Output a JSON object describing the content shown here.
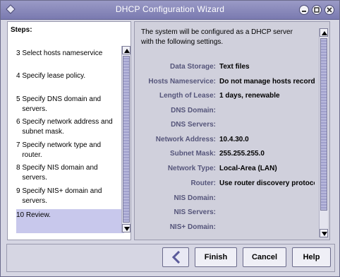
{
  "window": {
    "title": "DHCP Configuration Wizard"
  },
  "steps": {
    "heading": "Steps:",
    "items": [
      {
        "label": "3 Select hosts nameservice"
      },
      {
        "label": "4 Specify lease policy."
      },
      {
        "label": "5 Specify DNS domain and\n   servers."
      },
      {
        "label": "6 Specify network address and\n   subnet mask."
      },
      {
        "label": "7 Specify network type and\n   router."
      },
      {
        "label": "8 Specify NIS domain and\n   servers."
      },
      {
        "label": "9 Specify NIS+ domain and\n   servers."
      },
      {
        "label": "10 Review."
      }
    ],
    "active_index": 7
  },
  "review": {
    "intro": "The system will be configured as a DHCP server\nwith the following settings.",
    "fields": [
      {
        "label": "Data Storage:",
        "value": "Text files"
      },
      {
        "label": "Hosts Nameservice:",
        "value": "Do not manage hosts records"
      },
      {
        "label": "Length of Lease:",
        "value": "1 days, renewable"
      },
      {
        "label": "DNS Domain:",
        "value": ""
      },
      {
        "label": "DNS Servers:",
        "value": ""
      },
      {
        "label": "Network Address:",
        "value": "10.4.30.0"
      },
      {
        "label": "Subnet Mask:",
        "value": "255.255.255.0"
      },
      {
        "label": "Network Type:",
        "value": "Local-Area (LAN)"
      },
      {
        "label": "Router:",
        "value": "Use router discovery protocol"
      },
      {
        "label": "NIS Domain:",
        "value": ""
      },
      {
        "label": "NIS Servers:",
        "value": ""
      },
      {
        "label": "NIS+ Domain:",
        "value": ""
      }
    ]
  },
  "buttons": {
    "back_icon": "back-arrow-icon",
    "finish": "Finish",
    "cancel": "Cancel",
    "help": "Help"
  },
  "colors": {
    "titlebar": "#8a8abc",
    "active_step": "#c8c8ec",
    "label_text": "#55557a"
  }
}
